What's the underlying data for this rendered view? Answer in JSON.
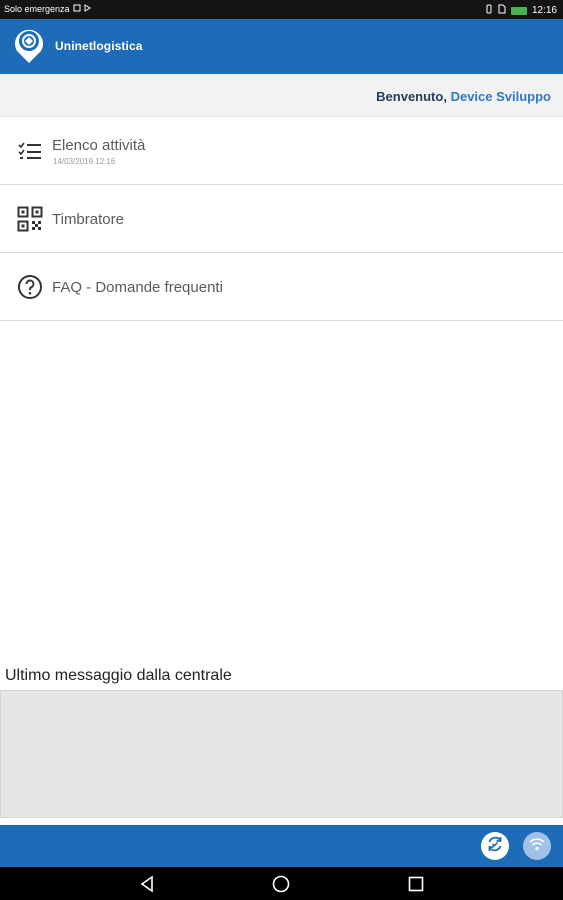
{
  "status_bar": {
    "carrier": "Solo emergenza",
    "time": "12:16"
  },
  "app_bar": {
    "title": "Uninetlogistica"
  },
  "welcome": {
    "greeting": "Benvenuto,",
    "user": "Device Sviluppo"
  },
  "menu": {
    "items": [
      {
        "label": "Elenco attività",
        "subtitle": "14/03/2019 12:16",
        "icon": "checklist-icon"
      },
      {
        "label": "Timbratore",
        "icon": "qr-code-icon"
      },
      {
        "label": "FAQ - Domande frequenti",
        "icon": "help-circle-icon"
      }
    ]
  },
  "message": {
    "title": "Ultimo messaggio dalla centrale",
    "body": ""
  },
  "bottom_bar": {
    "sync_icon": "sync-icon",
    "wifi_icon": "wifi-icon"
  },
  "colors": {
    "primary": "#1e6bb8",
    "user_link": "#2f79c9",
    "greeting": "#2a3a5c"
  }
}
